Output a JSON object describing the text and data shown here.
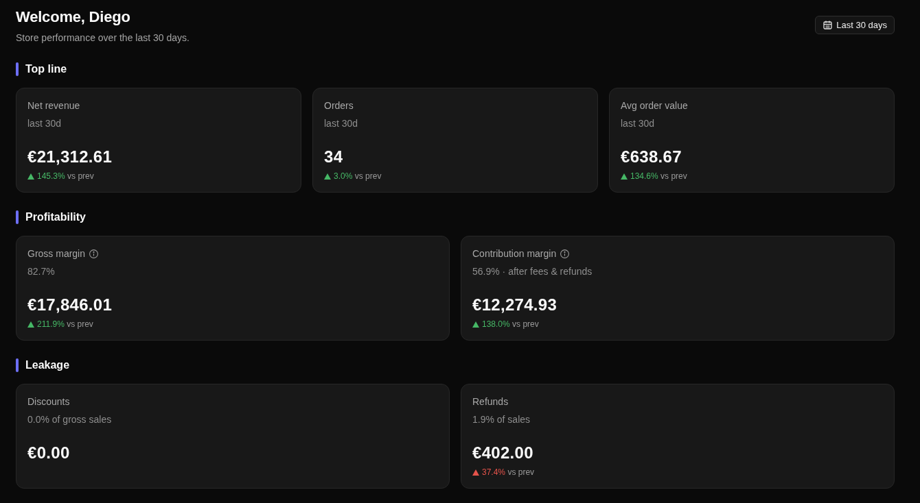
{
  "header": {
    "title": "Welcome, Diego",
    "subtitle": "Store performance over the last 30 days.",
    "range_button": "Last 30 days"
  },
  "sections": [
    {
      "title": "Top line",
      "cards": [
        {
          "label": "Net revenue",
          "info": false,
          "sublabel": "last 30d",
          "value": "€21,312.61",
          "delta": {
            "up": true,
            "color": "#46b866",
            "change": "145.3%",
            "suffix": "vs prev"
          }
        },
        {
          "label": "Orders",
          "info": false,
          "sublabel": "last 30d",
          "value": "34",
          "delta": {
            "up": true,
            "color": "#46b866",
            "change": "3.0%",
            "suffix": "vs prev"
          }
        },
        {
          "label": "Avg order value",
          "info": false,
          "sublabel": "last 30d",
          "value": "€638.67",
          "delta": {
            "up": true,
            "color": "#46b866",
            "change": "134.6%",
            "suffix": "vs prev"
          }
        }
      ]
    },
    {
      "title": "Profitability",
      "cards": [
        {
          "label": "Gross margin",
          "info": true,
          "sublabel": "82.7%",
          "value": "€17,846.01",
          "delta": {
            "up": true,
            "color": "#46b866",
            "change": "211.9%",
            "suffix": "vs prev"
          }
        },
        {
          "label": "Contribution margin",
          "info": true,
          "sublabel": "56.9% · after fees & refunds",
          "value": "€12,274.93",
          "delta": {
            "up": true,
            "color": "#46b866",
            "change": "138.0%",
            "suffix": "vs prev"
          }
        }
      ]
    },
    {
      "title": "Leakage",
      "cards": [
        {
          "label": "Discounts",
          "info": false,
          "sublabel": "0.0% of gross sales",
          "value": "€0.00"
        },
        {
          "label": "Refunds",
          "info": false,
          "sublabel": "1.9% of sales",
          "value": "€402.00",
          "delta": {
            "up": true,
            "color": "#e5534b",
            "change": "37.4%",
            "suffix": "vs prev"
          }
        }
      ]
    }
  ]
}
